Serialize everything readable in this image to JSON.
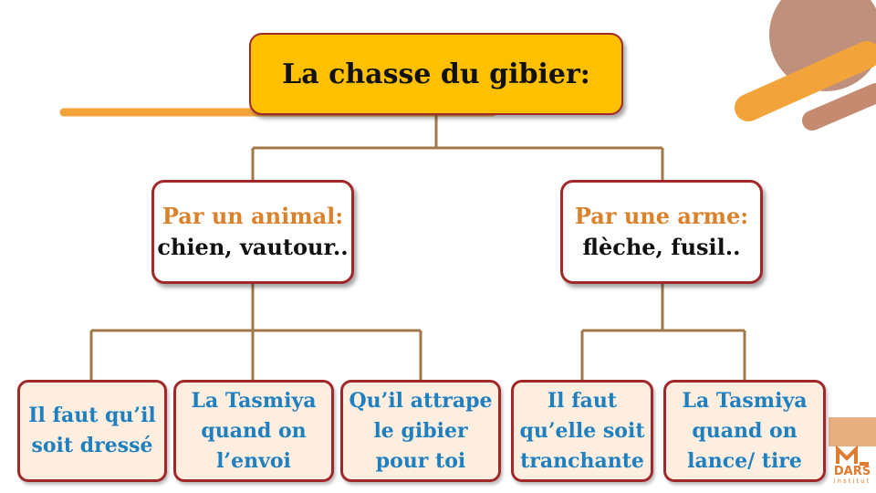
{
  "colors": {
    "root_fill": "#FFC000",
    "border": "#A0282A",
    "connector": "#A0784A",
    "category_label": "#D9822B",
    "leaf_text": "#1F7FBF",
    "leaf_fill": "#FDEEE0",
    "decoration_orange": "#F2A33A",
    "decoration_brown": "#B8846E"
  },
  "root": {
    "title": "La chasse du gibier:"
  },
  "branches": [
    {
      "label": "Par un animal:",
      "examples": "chien, vautour..",
      "children": [
        "Il faut qu’il\nsoit dressé",
        "La Tasmiya\nquand on\nl’envoi",
        "Qu’il attrape\nle gibier\npour toi"
      ]
    },
    {
      "label": "Par une arme:",
      "examples": "flèche, fusil..",
      "children": [
        "Il faut\nqu’elle soit\ntranchante",
        "La Tasmiya\nquand on\nlance/ tire"
      ]
    }
  ],
  "logo": {
    "text": "DARS",
    "subtext": "institut"
  }
}
